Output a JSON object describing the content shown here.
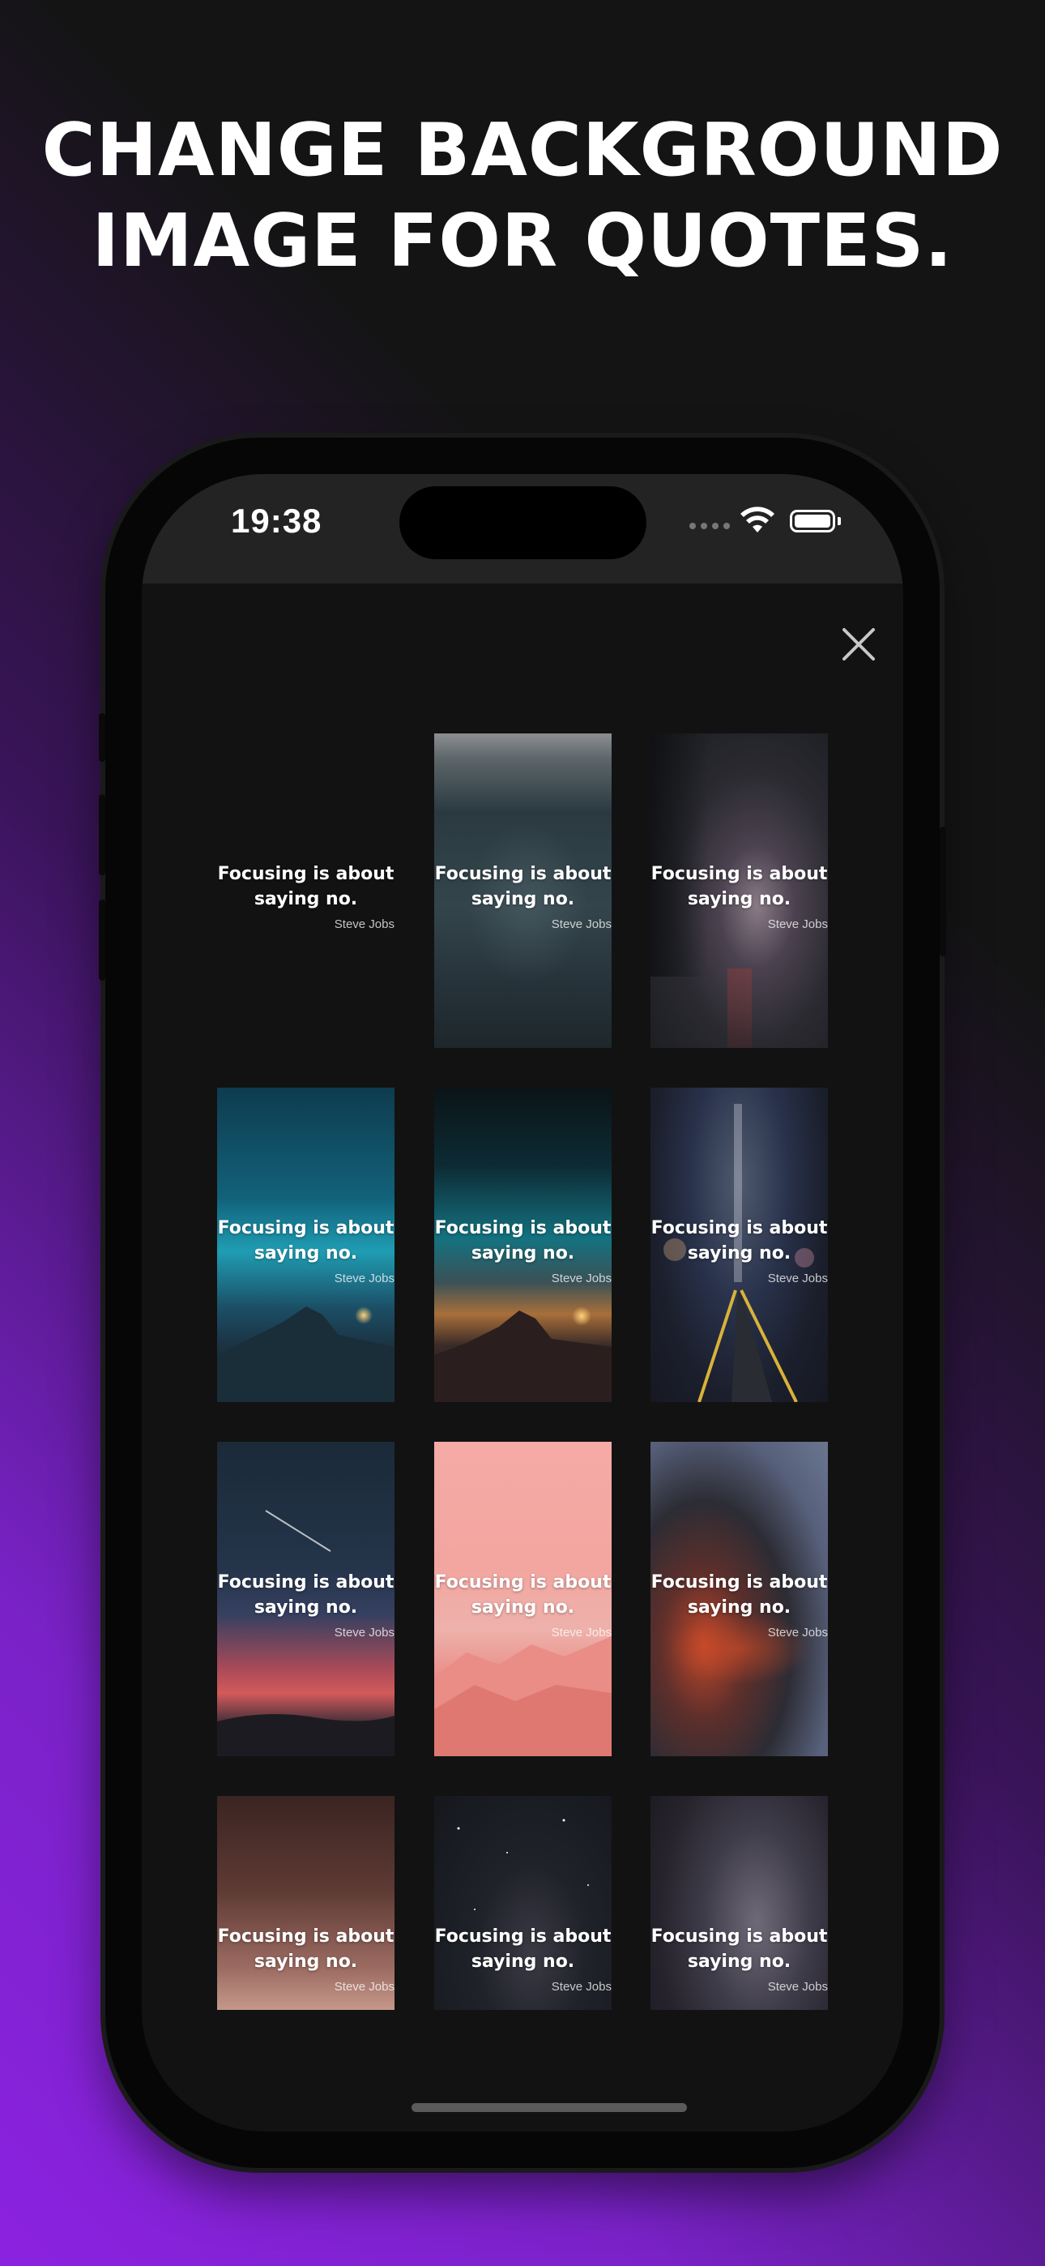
{
  "headline": {
    "line1": "CHANGE BACKGROUND",
    "line2": "IMAGE FOR QUOTES."
  },
  "status_bar": {
    "time": "19:38",
    "icons": [
      "cellular-signal-icon",
      "wifi-icon",
      "battery-icon"
    ]
  },
  "sheet": {
    "close_icon": "close-icon"
  },
  "backgrounds": [
    {
      "quote": "Focusing is about saying no.",
      "author": "Steve Jobs",
      "theme": "plain-dark"
    },
    {
      "quote": "Focusing is about saying no.",
      "author": "Steve Jobs",
      "theme": "blurred-city"
    },
    {
      "quote": "Focusing is about saying no.",
      "author": "Steve Jobs",
      "theme": "forest-road"
    },
    {
      "quote": "Focusing is about saying no.",
      "author": "Steve Jobs",
      "theme": "teal-mountain-night"
    },
    {
      "quote": "Focusing is about saying no.",
      "author": "Steve Jobs",
      "theme": "mountain-sunset-stars"
    },
    {
      "quote": "Focusing is about saying no.",
      "author": "Steve Jobs",
      "theme": "city-street-bokeh"
    },
    {
      "quote": "Focusing is about saying no.",
      "author": "Steve Jobs",
      "theme": "shooting-star-dusk"
    },
    {
      "quote": "Focusing is about saying no.",
      "author": "Steve Jobs",
      "theme": "pink-mountains"
    },
    {
      "quote": "Focusing is about saying no.",
      "author": "Steve Jobs",
      "theme": "red-clouds"
    },
    {
      "quote": "Focusing is about saying no.",
      "author": "Steve Jobs",
      "theme": "pastel-clouds"
    },
    {
      "quote": "Focusing is about saying no.",
      "author": "Steve Jobs",
      "theme": "starry-sky"
    },
    {
      "quote": "Focusing is about saying no.",
      "author": "Steve Jobs",
      "theme": "milky-way-rocks"
    }
  ],
  "colors": {
    "screen_bg": "#121212",
    "status_bg": "#232323",
    "text": "#ffffff",
    "gradient_purple": "#8b22e0"
  }
}
